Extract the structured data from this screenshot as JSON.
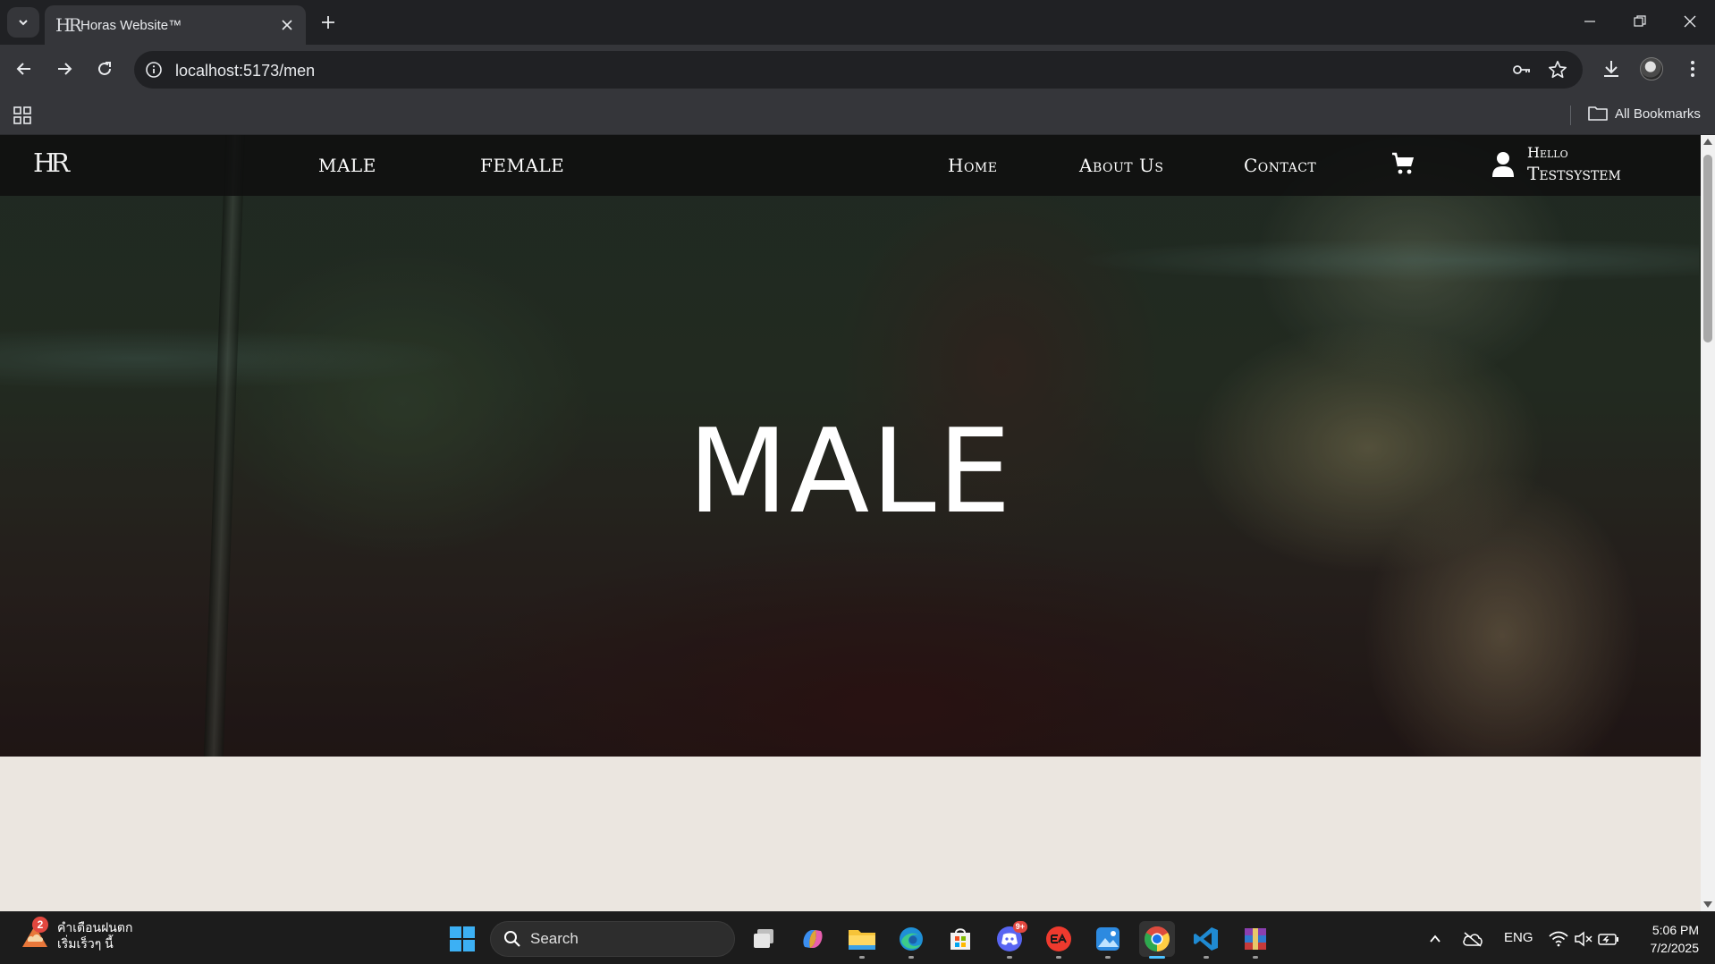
{
  "browser": {
    "tab": {
      "title": "Horas Website™",
      "favicon": "HR"
    },
    "url": "localhost:5173/men",
    "bookmarks": {
      "all_label": "All Bookmarks"
    }
  },
  "site": {
    "logo": "HR",
    "nav_left": [
      {
        "label": "MALE"
      },
      {
        "label": "FEMALE"
      }
    ],
    "nav_right": [
      {
        "label": "Home"
      },
      {
        "label": "About Us"
      },
      {
        "label": "Contact"
      }
    ],
    "user": {
      "greeting": "Hello",
      "name": "Testsystem"
    },
    "hero": {
      "title": "MALE"
    },
    "colors": {
      "body_bg": "#ebe6e0",
      "nav_bg": "#0f0f0f",
      "text": "#ffffff"
    }
  },
  "taskbar": {
    "weather": {
      "badge": "2",
      "line1": "คำเตือนฝนตก",
      "line2": "เริ่มเร็วๆ นี้"
    },
    "search_label": "Search",
    "discord_badge": "9+",
    "language": "ENG",
    "time": "5:06 PM",
    "date": "7/2/2025",
    "apps": [
      "task-view",
      "copilot",
      "file-explorer",
      "edge",
      "microsoft-store",
      "discord",
      "ea-app",
      "photos",
      "chrome",
      "vscode",
      "winrar"
    ]
  }
}
